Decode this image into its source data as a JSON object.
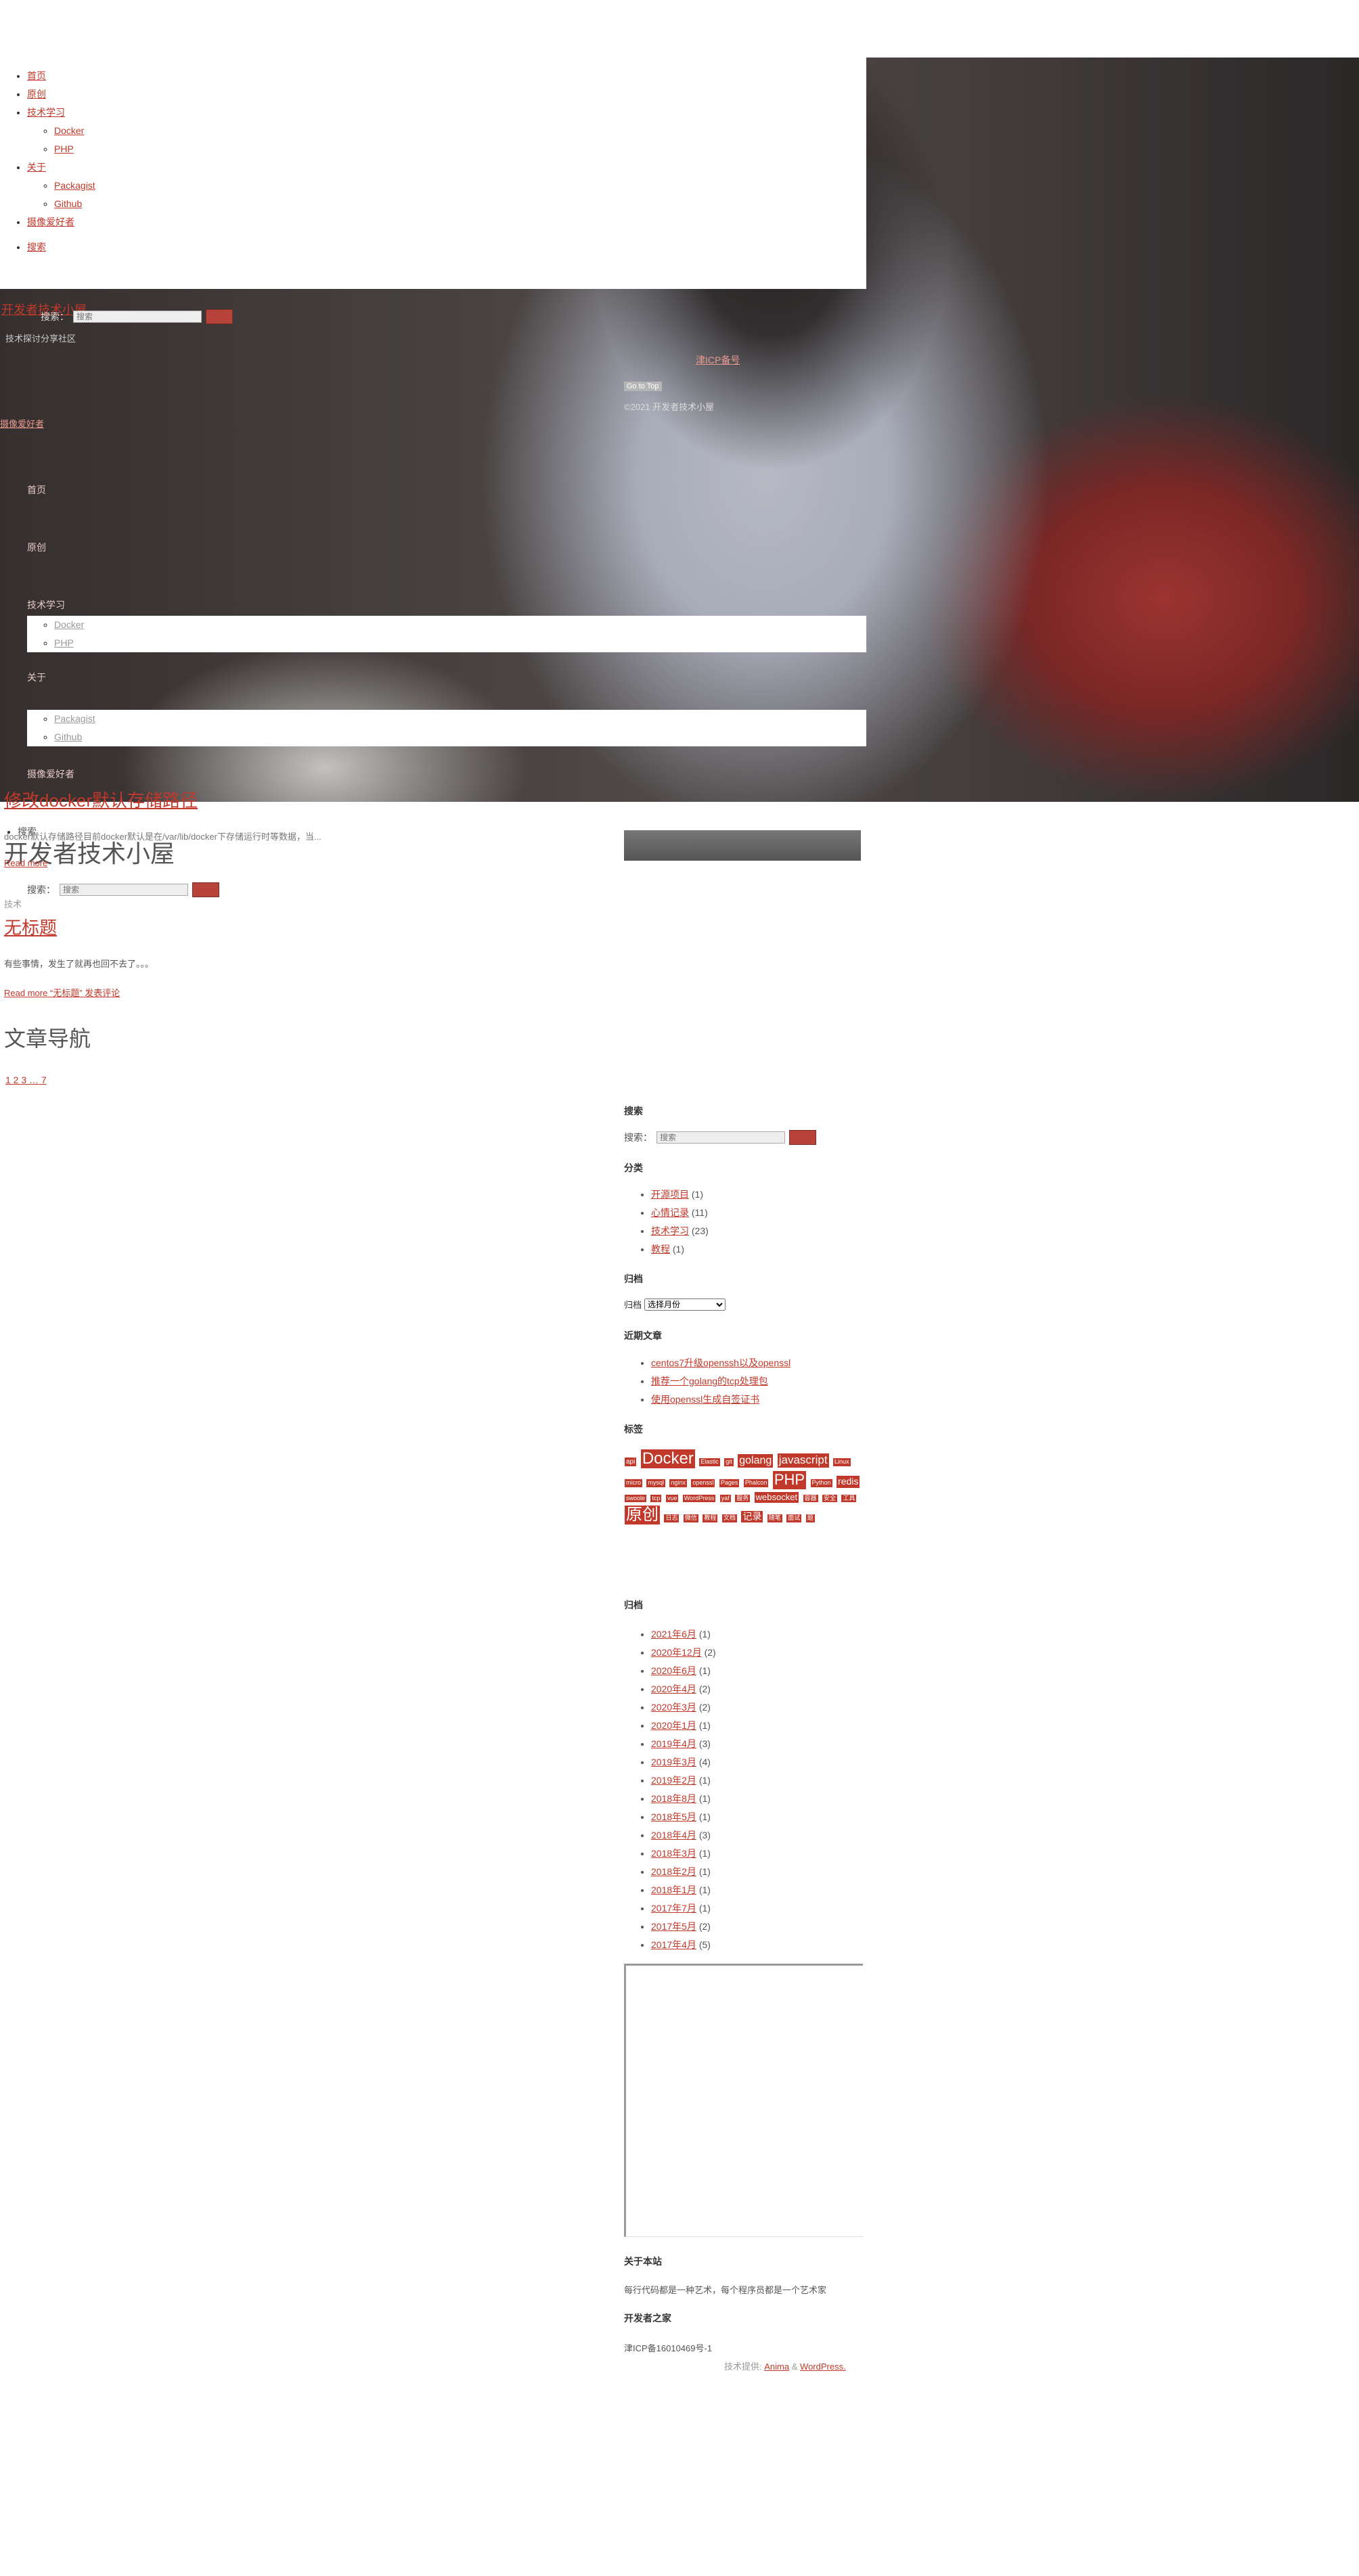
{
  "nav": {
    "items": [
      "首页",
      "原创",
      "技术学习",
      "关于",
      "摄像爱好者"
    ],
    "tech_sub": [
      "Docker",
      "PHP"
    ],
    "about_sub": [
      "Packagist",
      "Github"
    ],
    "search": "搜索"
  },
  "site": {
    "title": "开发者技术小屋",
    "tagline": "技术探讨分享社区",
    "small_link": "摄像爱好者"
  },
  "search": {
    "label": "搜索：",
    "placeholder": "搜索"
  },
  "hero_footer": {
    "icp_link": "津ICP备号",
    "badge": "Go to Top",
    "copyright": "©2021 开发者技术小屋"
  },
  "posts": {
    "first_title": "修改docker默认存储路径",
    "first_excerpt": "docker默认存储路径目前docker默认是在/var/lib/docker下存储运行时等数据，当...",
    "first_read": "Read more",
    "first_category": "技术",
    "second_title": "无标题",
    "second_excerpt": "有些事情，发生了就再也回不去了。。。",
    "second_read": "Read more “无标题” 发表评论"
  },
  "pagination": {
    "heading": "文章导航",
    "pages": "1 2 3 … 7"
  },
  "sidebar": {
    "search_title": "搜索",
    "category_title": "分类",
    "categories": [
      {
        "name": "开源项目",
        "count": "(1)"
      },
      {
        "name": "心情记录",
        "count": "(11)"
      },
      {
        "name": "技术学习",
        "count": "(23)"
      },
      {
        "name": "教程",
        "count": "(1)"
      }
    ],
    "archive_title": "归档",
    "archive_select_label": "归档",
    "archive_select_value": "选择月份",
    "recent_title": "近期文章",
    "recent": [
      "centos7升级openssh以及openssl",
      "推荐一个golang的tcp处理包",
      "使用openssl生成自签证书"
    ],
    "tags_title": "标签",
    "tags": [
      {
        "t": "api",
        "s": 10
      },
      {
        "t": "Docker",
        "s": 24
      },
      {
        "t": "Elastic",
        "s": 9
      },
      {
        "t": "git",
        "s": 9
      },
      {
        "t": "golang",
        "s": 16
      },
      {
        "t": "javascript",
        "s": 17
      },
      {
        "t": "Linux",
        "s": 9
      },
      {
        "t": "micro",
        "s": 9
      },
      {
        "t": "mysql",
        "s": 9
      },
      {
        "t": "nginx",
        "s": 9
      },
      {
        "t": "openssl",
        "s": 9
      },
      {
        "t": "Pages",
        "s": 9
      },
      {
        "t": "Phalcon",
        "s": 9
      },
      {
        "t": "PHP",
        "s": 22
      },
      {
        "t": "Python",
        "s": 9
      },
      {
        "t": "redis",
        "s": 14
      },
      {
        "t": "swoole",
        "s": 9
      },
      {
        "t": "tcp",
        "s": 9
      },
      {
        "t": "vue",
        "s": 9
      },
      {
        "t": "WordPress",
        "s": 9
      },
      {
        "t": "yaf",
        "s": 9
      },
      {
        "t": "服务",
        "s": 9
      },
      {
        "t": "websocket",
        "s": 13
      },
      {
        "t": "容器",
        "s": 9
      },
      {
        "t": "安全",
        "s": 9
      },
      {
        "t": "工具",
        "s": 9
      },
      {
        "t": "原创",
        "s": 24
      },
      {
        "t": "日志",
        "s": 9
      },
      {
        "t": "微信",
        "s": 9
      },
      {
        "t": "教程",
        "s": 9
      },
      {
        "t": "文档",
        "s": 9
      },
      {
        "t": "记录",
        "s": 14
      },
      {
        "t": "随笔",
        "s": 9
      },
      {
        "t": "面试",
        "s": 9
      },
      {
        "t": "题",
        "s": 9
      }
    ],
    "archives_title": "归档",
    "archives": [
      {
        "m": "2021年6月",
        "c": "(1)"
      },
      {
        "m": "2020年12月",
        "c": "(2)"
      },
      {
        "m": "2020年6月",
        "c": "(1)"
      },
      {
        "m": "2020年4月",
        "c": "(2)"
      },
      {
        "m": "2020年3月",
        "c": "(2)"
      },
      {
        "m": "2020年1月",
        "c": "(1)"
      },
      {
        "m": "2019年4月",
        "c": "(3)"
      },
      {
        "m": "2019年3月",
        "c": "(4)"
      },
      {
        "m": "2019年2月",
        "c": "(1)"
      },
      {
        "m": "2018年8月",
        "c": "(1)"
      },
      {
        "m": "2018年5月",
        "c": "(1)"
      },
      {
        "m": "2018年4月",
        "c": "(3)"
      },
      {
        "m": "2018年3月",
        "c": "(1)"
      },
      {
        "m": "2018年2月",
        "c": "(1)"
      },
      {
        "m": "2018年1月",
        "c": "(1)"
      },
      {
        "m": "2017年7月",
        "c": "(1)"
      },
      {
        "m": "2017年5月",
        "c": "(2)"
      },
      {
        "m": "2017年4月",
        "c": "(5)"
      }
    ],
    "about_title": "关于本站",
    "about_text": "每行代码都是一种艺术，每个程序员都是一个艺术家",
    "dev_home_title": "开发者之家",
    "icp": "津ICP备16010469号-1"
  },
  "footer": {
    "prefix": "技术提供:",
    "anima": "Anima",
    "amp": "&",
    "wordpress": "WordPress."
  }
}
